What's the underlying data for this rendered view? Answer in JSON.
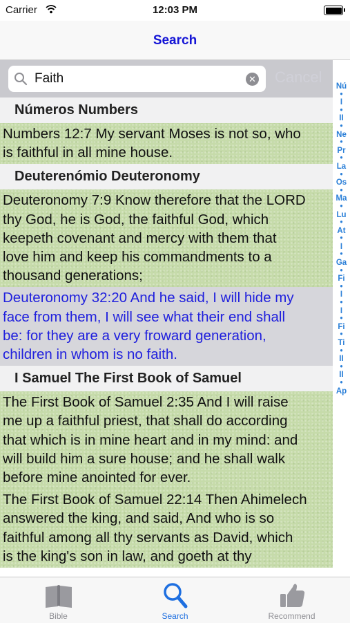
{
  "status_bar": {
    "carrier": "Carrier",
    "time": "12:03 PM"
  },
  "nav": {
    "title": "Search"
  },
  "search": {
    "value": "Faith",
    "cancel_label": "Cancel"
  },
  "sections": [
    {
      "header": "Números Numbers",
      "rows": [
        {
          "selected": false,
          "lines": [
            "Numbers 12:7 My servant Moses is not so, who",
            "is faithful in all mine house."
          ]
        }
      ]
    },
    {
      "header": "Deuterenómio Deuteronomy",
      "rows": [
        {
          "selected": false,
          "lines": [
            "Deuteronomy 7:9 Know therefore that the LORD",
            "thy God, he is God, the faithful God, which",
            "keepeth covenant and mercy with them that",
            "love him and keep his commandments to a",
            "thousand generations;"
          ]
        },
        {
          "selected": true,
          "lines": [
            "Deuteronomy 32:20 And he said, I will hide my",
            "face from them, I will see what their end shall",
            "be: for they are a very froward generation,",
            "children in whom is no faith."
          ]
        }
      ]
    },
    {
      "header": "I Samuel The First Book of Samuel",
      "rows": [
        {
          "selected": false,
          "lines": [
            "The First Book of Samuel 2:35 And I will raise",
            "me up a faithful priest, that shall do according",
            "that which is in mine heart and in my mind: and",
            "will build him a sure house; and he shall walk",
            "before mine anointed for ever."
          ]
        },
        {
          "selected": false,
          "lines": [
            "The First Book of Samuel 22:14 Then Ahimelech",
            "answered the king, and said, And who is so",
            "faithful among all thy servants as David, which",
            "is the king's son in law, and goeth at thy"
          ]
        }
      ]
    }
  ],
  "index": [
    "Nú",
    "•",
    "I",
    "•",
    "II",
    "•",
    "Ne",
    "•",
    "Pr",
    "•",
    "La",
    "•",
    "Os",
    "•",
    "Ma",
    "•",
    "Lu",
    "•",
    "At",
    "•",
    "I",
    "•",
    "Ga",
    "•",
    "Fi",
    "•",
    "I",
    "•",
    "I",
    "•",
    "Fi",
    "•",
    "Ti",
    "•",
    "II",
    "•",
    "II",
    "•",
    "Ap"
  ],
  "tabs": [
    {
      "label": "Bible",
      "icon": "book-icon",
      "active": false
    },
    {
      "label": "Search",
      "icon": "magnifier-icon",
      "active": true
    },
    {
      "label": "Recommend",
      "icon": "thumbs-up-icon",
      "active": false
    }
  ],
  "colors": {
    "accent": "#1414d6",
    "tab_active": "#1e6fe0",
    "index_blue": "#2a7fd8",
    "row_green": "#c6dbaa",
    "selected_text": "#2020dd"
  }
}
